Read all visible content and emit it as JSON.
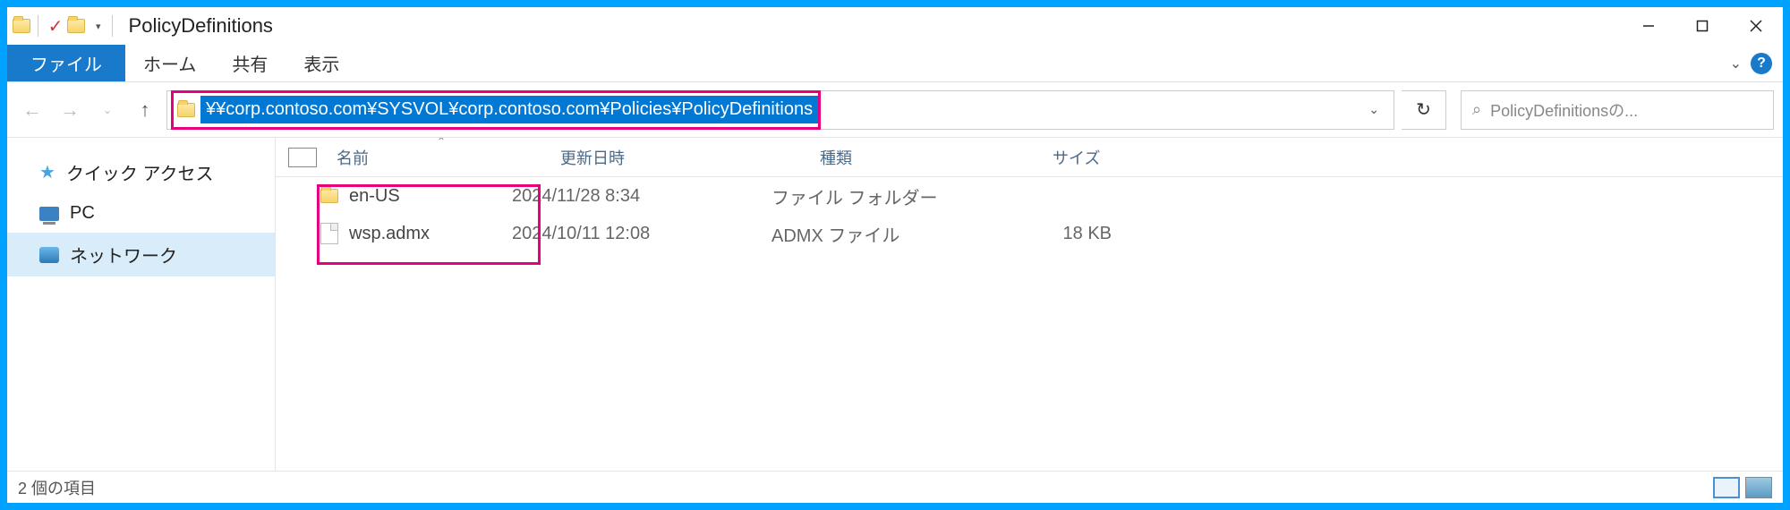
{
  "title": "PolicyDefinitions",
  "ribbon": {
    "file": "ファイル",
    "home": "ホーム",
    "share": "共有",
    "view": "表示"
  },
  "address_path": "¥¥corp.contoso.com¥SYSVOL¥corp.contoso.com¥Policies¥PolicyDefinitions",
  "search_placeholder": "PolicyDefinitionsの...",
  "sidebar": {
    "quick_access": "クイック アクセス",
    "pc": "PC",
    "network": "ネットワーク"
  },
  "columns": {
    "name": "名前",
    "date": "更新日時",
    "type": "種類",
    "size": "サイズ"
  },
  "rows": [
    {
      "name": "en-US",
      "date": "2024/11/28 8:34",
      "type": "ファイル フォルダー",
      "size": ""
    },
    {
      "name": "wsp.admx",
      "date": "2024/10/11 12:08",
      "type": "ADMX ファイル",
      "size": "18 KB"
    }
  ],
  "status": "2 個の項目"
}
